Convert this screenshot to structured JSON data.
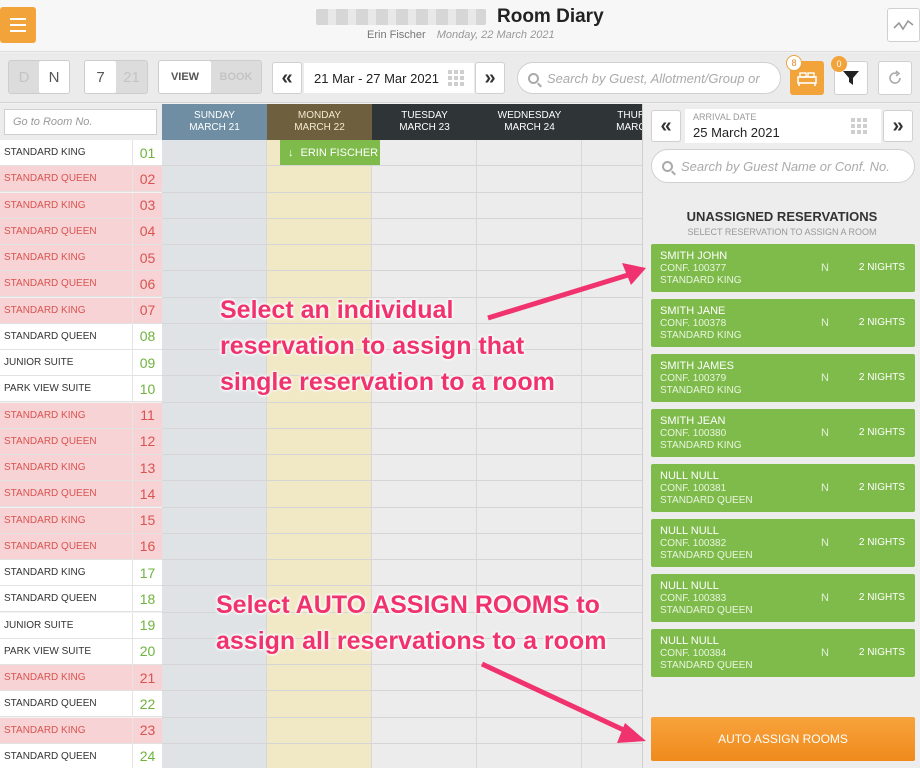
{
  "header": {
    "title": "Room Diary",
    "user": "Erin Fischer",
    "date": "Monday, 22 March 2021"
  },
  "toolbar": {
    "mode_d": "D",
    "mode_n": "N",
    "days_7": "7",
    "days_21": "21",
    "view_label": "VIEW",
    "book_label": "BOOK",
    "prev_icon": "«",
    "next_icon": "»",
    "date_range": "21 Mar - 27 Mar 2021",
    "search_placeholder": "Search by Guest, Allotment/Group or",
    "housekeeping_count": "8",
    "filter_count": "0"
  },
  "grid": {
    "room_search_placeholder": "Go to Room No.",
    "days": [
      {
        "dow": "SUNDAY",
        "date": "MARCH 21"
      },
      {
        "dow": "MONDAY",
        "date": "MARCH 22"
      },
      {
        "dow": "TUESDAY",
        "date": "MARCH 23"
      },
      {
        "dow": "WEDNESDAY",
        "date": "MARCH 24"
      },
      {
        "dow": "THURS",
        "date": "MARCH"
      }
    ],
    "rooms": [
      {
        "type": "STANDARD KING",
        "num": "01",
        "status": "clean"
      },
      {
        "type": "STANDARD QUEEN",
        "num": "02",
        "status": "dirty"
      },
      {
        "type": "STANDARD KING",
        "num": "03",
        "status": "dirty"
      },
      {
        "type": "STANDARD QUEEN",
        "num": "04",
        "status": "dirty"
      },
      {
        "type": "STANDARD KING",
        "num": "05",
        "status": "dirty"
      },
      {
        "type": "STANDARD QUEEN",
        "num": "06",
        "status": "dirty"
      },
      {
        "type": "STANDARD KING",
        "num": "07",
        "status": "dirty"
      },
      {
        "type": "STANDARD QUEEN",
        "num": "08",
        "status": "clean"
      },
      {
        "type": "JUNIOR SUITE",
        "num": "09",
        "status": "clean"
      },
      {
        "type": "PARK VIEW SUITE",
        "num": "10",
        "status": "clean"
      },
      {
        "type": "STANDARD KING",
        "num": "11",
        "status": "dirty"
      },
      {
        "type": "STANDARD QUEEN",
        "num": "12",
        "status": "dirty"
      },
      {
        "type": "STANDARD KING",
        "num": "13",
        "status": "dirty"
      },
      {
        "type": "STANDARD QUEEN",
        "num": "14",
        "status": "dirty"
      },
      {
        "type": "STANDARD KING",
        "num": "15",
        "status": "dirty"
      },
      {
        "type": "STANDARD QUEEN",
        "num": "16",
        "status": "dirty"
      },
      {
        "type": "STANDARD KING",
        "num": "17",
        "status": "clean"
      },
      {
        "type": "STANDARD QUEEN",
        "num": "18",
        "status": "clean"
      },
      {
        "type": "JUNIOR SUITE",
        "num": "19",
        "status": "clean"
      },
      {
        "type": "PARK VIEW SUITE",
        "num": "20",
        "status": "clean"
      },
      {
        "type": "STANDARD KING",
        "num": "21",
        "status": "dirty"
      },
      {
        "type": "STANDARD QUEEN",
        "num": "22",
        "status": "clean"
      },
      {
        "type": "STANDARD KING",
        "num": "23",
        "status": "dirty"
      },
      {
        "type": "STANDARD QUEEN",
        "num": "24",
        "status": "clean"
      }
    ],
    "booking": {
      "guest": "ERIN FISCHER",
      "icon": "↓"
    }
  },
  "panel": {
    "arrival_label": "ARRIVAL DATE",
    "arrival_date": "25 March 2021",
    "prev_icon": "«",
    "next_icon": "»",
    "search_placeholder": "Search by Guest Name or Conf. No.",
    "title": "UNASSIGNED RESERVATIONS",
    "subtitle": "SELECT RESERVATION TO ASSIGN A ROOM",
    "reservations": [
      {
        "name": "SMITH JOHN",
        "conf": "CONF. 100377",
        "type": "STANDARD KING",
        "flag": "N",
        "nights": "2 NIGHTS"
      },
      {
        "name": "SMITH JANE",
        "conf": "CONF. 100378",
        "type": "STANDARD KING",
        "flag": "N",
        "nights": "2 NIGHTS"
      },
      {
        "name": "SMITH JAMES",
        "conf": "CONF. 100379",
        "type": "STANDARD KING",
        "flag": "N",
        "nights": "2 NIGHTS"
      },
      {
        "name": "SMITH JEAN",
        "conf": "CONF. 100380",
        "type": "STANDARD KING",
        "flag": "N",
        "nights": "2 NIGHTS"
      },
      {
        "name": "NULL NULL",
        "conf": "CONF. 100381",
        "type": "STANDARD QUEEN",
        "flag": "N",
        "nights": "2 NIGHTS"
      },
      {
        "name": "NULL NULL",
        "conf": "CONF. 100382",
        "type": "STANDARD QUEEN",
        "flag": "N",
        "nights": "2 NIGHTS"
      },
      {
        "name": "NULL NULL",
        "conf": "CONF. 100383",
        "type": "STANDARD QUEEN",
        "flag": "N",
        "nights": "2 NIGHTS"
      },
      {
        "name": "NULL NULL",
        "conf": "CONF. 100384",
        "type": "STANDARD QUEEN",
        "flag": "N",
        "nights": "2 NIGHTS"
      }
    ],
    "auto_assign_label": "AUTO ASSIGN ROOMS"
  },
  "annotations": {
    "callout_1": [
      "Select an individual",
      "reservation to assign that",
      "single reservation to a room"
    ],
    "callout_2": [
      "Select AUTO ASSIGN ROOMS to",
      "assign all reservations to a room"
    ]
  },
  "colors": {
    "accent_orange": "#f08a1c",
    "reservation_green": "#7ebb4a",
    "dirty_pink": "#f7d3d6",
    "dirty_text": "#d9534f",
    "annotation_pink": "#f0336e"
  }
}
